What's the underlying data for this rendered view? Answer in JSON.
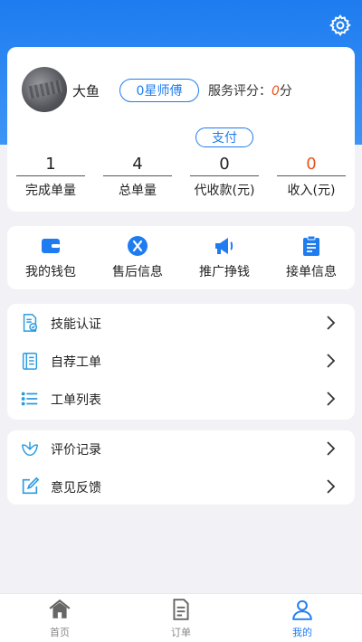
{
  "profile": {
    "name": "大鱼",
    "level": "0星师傅",
    "score_label": "服务评分：",
    "score_value": "0",
    "score_unit": "分",
    "pay_label": "支付"
  },
  "stats": [
    {
      "value": "1",
      "label": "完成单量"
    },
    {
      "value": "4",
      "label": "总单量"
    },
    {
      "value": "0",
      "label": "代收款(元)"
    },
    {
      "value": "0",
      "label": "收入(元)"
    }
  ],
  "quick_actions": [
    {
      "label": "我的钱包",
      "icon": "wallet-icon"
    },
    {
      "label": "售后信息",
      "icon": "after-sales-icon"
    },
    {
      "label": "推广挣钱",
      "icon": "megaphone-icon"
    },
    {
      "label": "接单信息",
      "icon": "clipboard-icon"
    }
  ],
  "menu_group1": [
    {
      "label": "技能认证",
      "icon": "certificate-icon"
    },
    {
      "label": "自荐工单",
      "icon": "notebook-icon"
    },
    {
      "label": "工单列表",
      "icon": "list-icon"
    }
  ],
  "menu_group2": [
    {
      "label": "评价记录",
      "icon": "review-icon"
    },
    {
      "label": "意见反馈",
      "icon": "feedback-edit-icon"
    }
  ],
  "tabbar": [
    {
      "label": "首页",
      "icon": "home-icon"
    },
    {
      "label": "订单",
      "icon": "order-icon"
    },
    {
      "label": "我的",
      "icon": "user-icon"
    }
  ],
  "colors": {
    "accent": "#1e7cf0",
    "highlight": "#e8541e",
    "background": "#f2f2f6"
  }
}
